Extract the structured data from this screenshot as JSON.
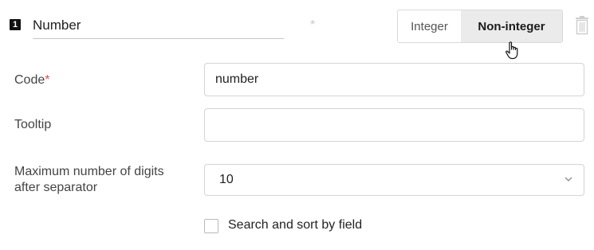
{
  "field": {
    "index": "1",
    "name_value": "Number",
    "required_marker": "*"
  },
  "type_toggle": {
    "options": [
      "Integer",
      "Non-integer"
    ],
    "selected": "Non-integer"
  },
  "form": {
    "code": {
      "label": "Code",
      "required_marker": "*",
      "value": "number"
    },
    "tooltip": {
      "label": "Tooltip",
      "value": ""
    },
    "max_digits": {
      "label_line1": "Maximum number of digits",
      "label_line2": "after separator",
      "selected_value": "10"
    },
    "search_sort": {
      "label": "Search and sort by field",
      "checked": false
    }
  },
  "icons": {
    "delete": "trash-icon",
    "cursor": "hand-pointer-cursor-icon",
    "select_arrow": "chevron-down-icon"
  },
  "colors": {
    "required": "#d9534f",
    "toggle_active_bg": "#ebebeb",
    "border": "#d4d4d4"
  }
}
